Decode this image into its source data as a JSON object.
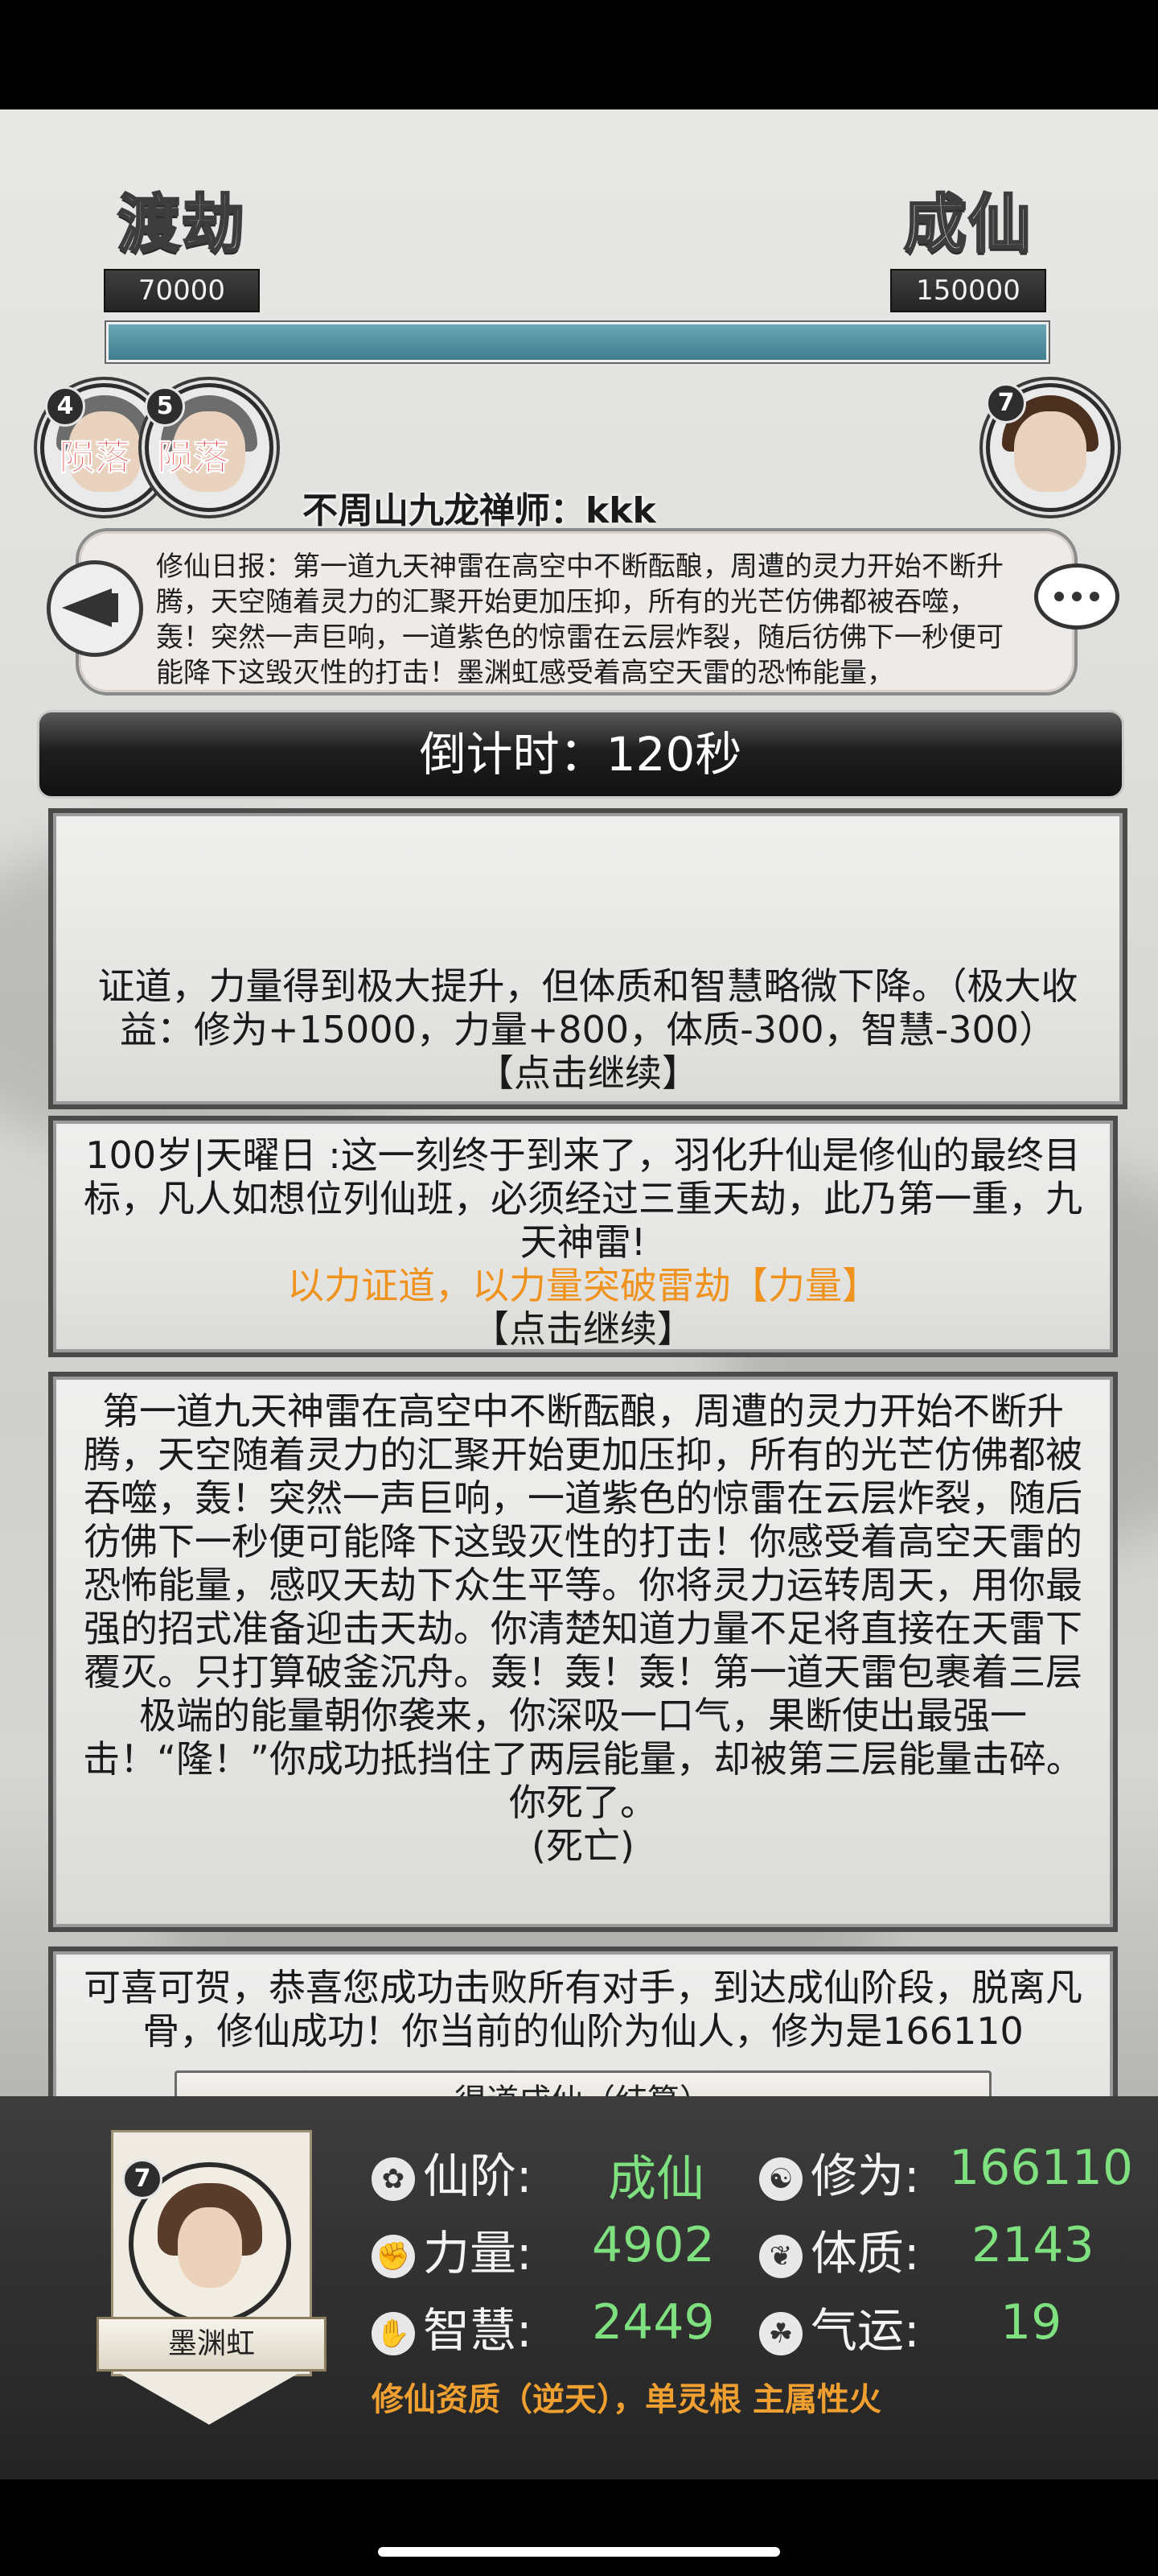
{
  "stages": {
    "left": {
      "title": "渡劫",
      "value": "70000"
    },
    "right": {
      "title": "成仙",
      "value": "150000"
    },
    "progress_fraction": 1.0
  },
  "opponents": [
    {
      "level": "4",
      "status": "陨落"
    },
    {
      "level": "5",
      "status": "陨落"
    }
  ],
  "self_avatar_level": "7",
  "player_name": "不周山九龙禅师：kkk",
  "daily_report": "修仙日报：第一道九天神雷在高空中不断酝酿，周遭的灵力开始不断升腾，天空随着灵力的汇聚开始更加压抑，所有的光芒仿佛都被吞噬，轰！突然一声巨响，一道紫色的惊雷在云层炸裂，随后彷佛下一秒便可能降下这毁灭性的打击！墨渊虹感受着高空天雷的恐怖能量，",
  "countdown": "倒计时：120秒",
  "cards": {
    "card1": {
      "text": "证道，力量得到极大提升，但体质和智慧略微下降。（极大收益：修为+15000，力量+800，体质-300，智慧-300）",
      "continue": "【点击继续】"
    },
    "card2": {
      "text": "100岁|天曜日 :这一刻终于到来了，羽化升仙是修仙的最终目标，凡人如想位列仙班，必须经过三重天劫，此乃第一重，九天神雷!",
      "highlight": "以力证道，以力量突破雷劫【力量】",
      "continue": "【点击继续】"
    },
    "card3": {
      "text": "第一道九天神雷在高空中不断酝酿，周遭的灵力开始不断升腾，天空随着灵力的汇聚开始更加压抑，所有的光芒仿佛都被吞噬，轰！突然一声巨响，一道紫色的惊雷在云层炸裂，随后彷佛下一秒便可能降下这毁灭性的打击！你感受着高空天雷的恐怖能量，感叹天劫下众生平等。你将灵力运转周天，用你最强的招式准备迎击天劫。你清楚知道力量不足将直接在天雷下覆灭。只打算破釜沉舟。轰！轰！轰！第一道天雷包裹着三层极端的能量朝你袭来，你深吸一口气，果断使出最强一击！“隆！”你成功抵挡住了两层能量，却被第三层能量击碎。你死了。",
      "result": "(死亡)"
    },
    "card4": {
      "text": "可喜可贺，恭喜您成功击败所有对手，到达成仙阶段，脱离凡骨，修仙成功！你当前的仙阶为仙人，修为是166110",
      "button": "得道成仙（结算）"
    }
  },
  "character": {
    "name": "墨渊虹",
    "level": "7",
    "stats": {
      "rank_label": "仙阶:",
      "rank_value": "成仙",
      "cultivation_label": "修为:",
      "cultivation_value": "166110",
      "strength_label": "力量:",
      "strength_value": "4902",
      "physique_label": "体质:",
      "physique_value": "2143",
      "wisdom_label": "智慧:",
      "wisdom_value": "2449",
      "luck_label": "气运:",
      "luck_value": "19"
    },
    "aptitude": "修仙资质（逆天），单灵根 主属性火"
  },
  "icons": {
    "rank": "lotus-icon",
    "cultivation": "swirl-icon",
    "strength": "fist-icon",
    "physique": "leaf-icon",
    "wisdom": "hand-icon",
    "luck": "clover-icon"
  }
}
